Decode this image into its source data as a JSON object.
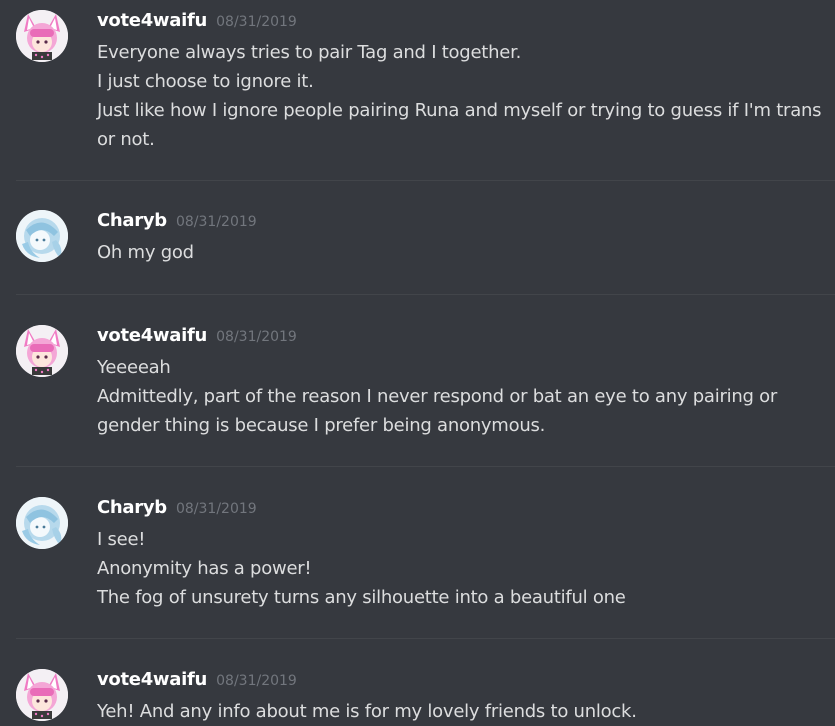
{
  "messages": [
    {
      "author": "vote4waifu",
      "timestamp": "08/31/2019",
      "avatar_icon": "pink-hair-girl-avatar-icon",
      "lines": [
        "Everyone always tries to pair Tag and I together.",
        "I just choose to ignore it.",
        "Just like how I ignore people pairing Runa and myself or trying to guess if I'm trans",
        "or not."
      ]
    },
    {
      "author": "Charyb",
      "timestamp": "08/31/2019",
      "avatar_icon": "blue-hair-girl-avatar-icon",
      "lines": [
        "Oh my god"
      ]
    },
    {
      "author": "vote4waifu",
      "timestamp": "08/31/2019",
      "avatar_icon": "pink-hair-girl-avatar-icon",
      "lines": [
        "Yeeeeah",
        "Admittedly, part of the reason I never respond or bat an eye to any pairing or",
        "gender thing is because I prefer being anonymous."
      ]
    },
    {
      "author": "Charyb",
      "timestamp": "08/31/2019",
      "avatar_icon": "blue-hair-girl-avatar-icon",
      "lines": [
        "I see!",
        "Anonymity has a power!",
        "The fog of unsurety turns any silhouette into a beautiful one"
      ]
    },
    {
      "author": "vote4waifu",
      "timestamp": "08/31/2019",
      "avatar_icon": "pink-hair-girl-avatar-icon",
      "lines": [
        "Yeh! And any info about me is for my lovely friends to unlock."
      ]
    }
  ],
  "colors": {
    "background": "#36393f",
    "username": "#ffffff",
    "timestamp": "#72767d",
    "message_text": "#dcddde",
    "divider": "#42454a"
  }
}
